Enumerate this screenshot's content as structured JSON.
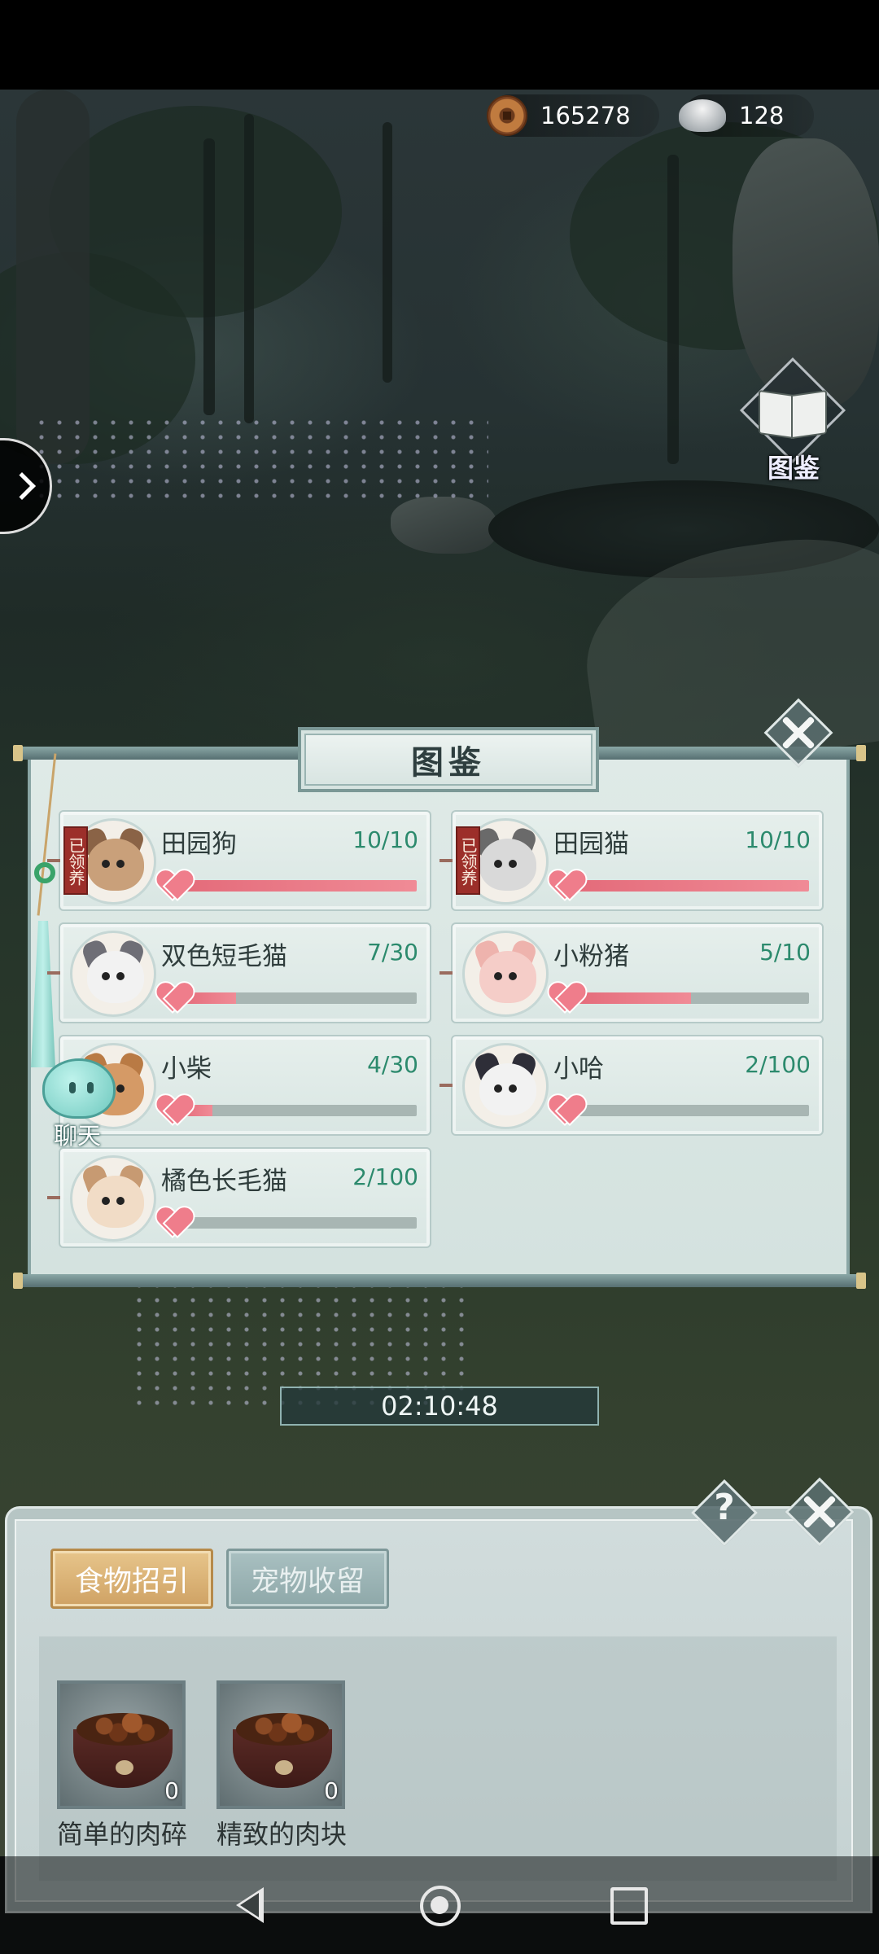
{
  "currency": {
    "coins": "165278",
    "silver": "128"
  },
  "handbook_entry": {
    "label": "图鉴",
    "icon": "open-book-icon"
  },
  "handbook": {
    "title": "图鉴",
    "pets": [
      {
        "name": "田园狗",
        "count": "10/10",
        "progress": 1.0,
        "adopted_seal": "已领养",
        "adopted": true,
        "fur": "#c9a07a",
        "ears": "#8a6346"
      },
      {
        "name": "田园猫",
        "count": "10/10",
        "progress": 1.0,
        "adopted_seal": "已领养",
        "adopted": true,
        "fur": "#d9d9d9",
        "ears": "#6a6a6a"
      },
      {
        "name": "双色短毛猫",
        "count": "7/30",
        "progress": 0.233,
        "fur": "#f2f2f2",
        "ears": "#6e6e76"
      },
      {
        "name": "小粉猪",
        "count": "5/10",
        "progress": 0.5,
        "fur": "#f5cdc8",
        "ears": "#eeb3ad"
      },
      {
        "name": "小柴",
        "count": "4/30",
        "progress": 0.133,
        "fur": "#d59a66",
        "ears": "#b97a44"
      },
      {
        "name": "小哈",
        "count": "2/100",
        "progress": 0.02,
        "fur": "#f2f2f2",
        "ears": "#2e2e38"
      },
      {
        "name": "橘色长毛猫",
        "count": "2/100",
        "progress": 0.02,
        "fur": "#f1dcc6",
        "ears": "#c79a72"
      }
    ]
  },
  "chat": {
    "label": "聊天"
  },
  "timer": "02:10:48",
  "food_panel": {
    "help": "?",
    "tabs": [
      {
        "label": "食物招引",
        "active": true
      },
      {
        "label": "宠物收留",
        "active": false
      }
    ],
    "items": [
      {
        "name": "简单的肉碎",
        "qty": "0"
      },
      {
        "name": "精致的肉块",
        "qty": "0"
      }
    ]
  },
  "colors": {
    "progress_fill": "#e46b7a",
    "count_text": "#2c8a6d",
    "active_tab": "#cfa264"
  }
}
